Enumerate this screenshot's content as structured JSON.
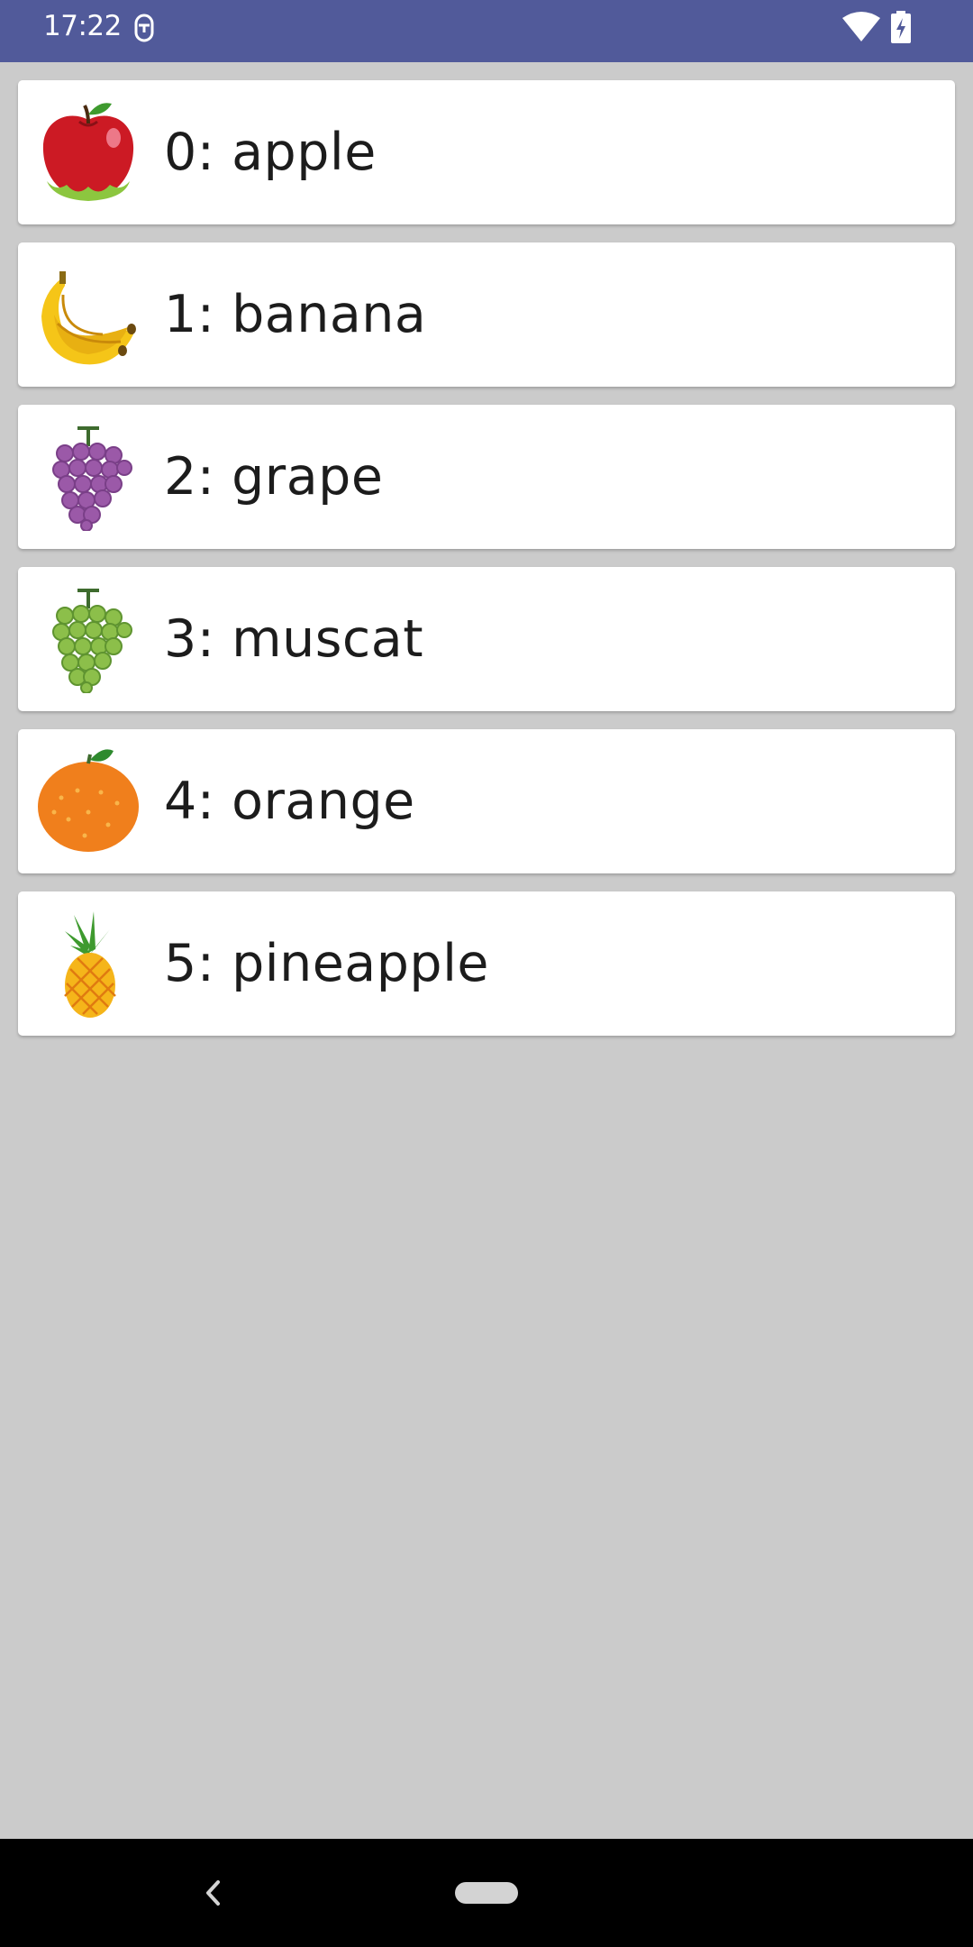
{
  "status_bar": {
    "time": "17:22",
    "icons": [
      "notification-icon",
      "wifi-icon",
      "battery-charging-icon"
    ],
    "background_color": "#515a9a"
  },
  "fruits": [
    {
      "label": "0: apple",
      "icon": "apple-icon"
    },
    {
      "label": "1: banana",
      "icon": "banana-icon"
    },
    {
      "label": "2: grape",
      "icon": "grape-icon"
    },
    {
      "label": "3: muscat",
      "icon": "muscat-icon"
    },
    {
      "label": "4: orange",
      "icon": "orange-icon"
    },
    {
      "label": "5: pineapple",
      "icon": "pineapple-icon"
    }
  ],
  "nav_bar": {
    "icons": [
      "back-icon",
      "home-pill-icon"
    ]
  }
}
